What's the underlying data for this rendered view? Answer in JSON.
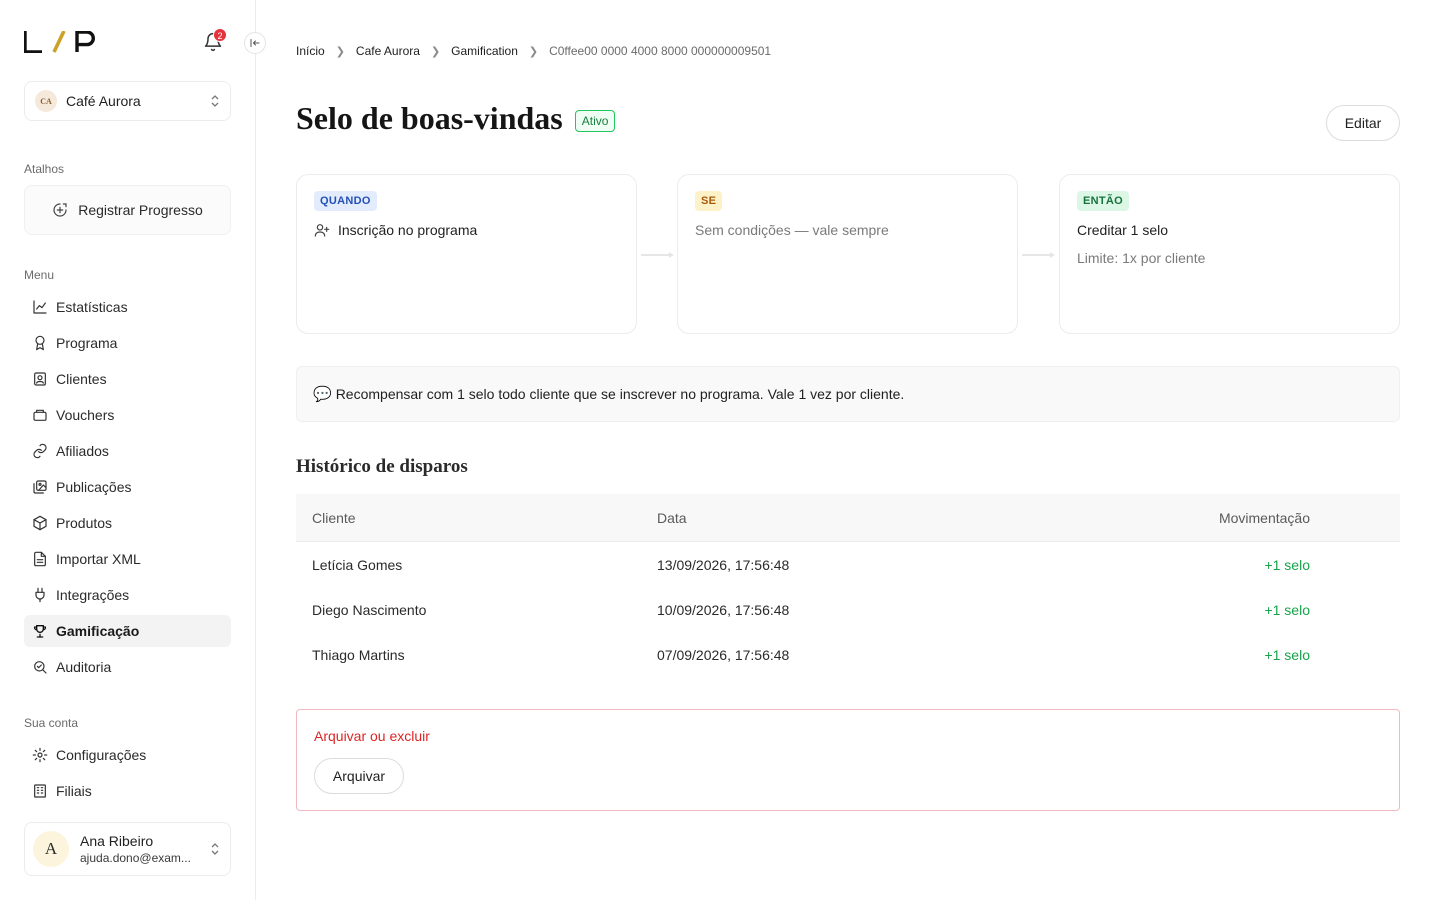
{
  "sidebar": {
    "logo_text": "L/P",
    "notifications_count": "2",
    "company": {
      "initials": "CA",
      "name": "Café Aurora"
    },
    "shortcuts_label": "Atalhos",
    "shortcut_button": "Registrar Progresso",
    "menu_label": "Menu",
    "menu_items": [
      {
        "label": "Estatísticas",
        "icon": "chart-line-icon"
      },
      {
        "label": "Programa",
        "icon": "award-icon"
      },
      {
        "label": "Clientes",
        "icon": "contact-card-icon"
      },
      {
        "label": "Vouchers",
        "icon": "ticket-icon"
      },
      {
        "label": "Afiliados",
        "icon": "link-icon"
      },
      {
        "label": "Publicações",
        "icon": "images-icon"
      },
      {
        "label": "Produtos",
        "icon": "package-icon"
      },
      {
        "label": "Importar XML",
        "icon": "file-icon"
      },
      {
        "label": "Integrações",
        "icon": "plug-icon"
      },
      {
        "label": "Gamificação",
        "icon": "trophy-icon",
        "active": true
      },
      {
        "label": "Auditoria",
        "icon": "search-audit-icon"
      }
    ],
    "account_label": "Sua conta",
    "account_items": [
      {
        "label": "Configurações",
        "icon": "gear-icon"
      },
      {
        "label": "Filiais",
        "icon": "building-icon"
      }
    ],
    "user": {
      "initial": "A",
      "name": "Ana Ribeiro",
      "email": "ajuda.dono@exam..."
    }
  },
  "breadcrumb": [
    "Início",
    "Cafe Aurora",
    "Gamification",
    "C0ffee00 0000 4000 8000 000000009501"
  ],
  "page": {
    "title": "Selo de boas-vindas",
    "status": "Ativo",
    "edit_button": "Editar"
  },
  "rule": {
    "when": {
      "tag": "QUANDO",
      "text": "Inscrição no programa"
    },
    "if": {
      "tag": "SE",
      "text": "Sem condições — vale sempre"
    },
    "then": {
      "tag": "ENTÃO",
      "text": "Creditar 1 selo",
      "sub": "Limite: 1x por cliente"
    }
  },
  "note": {
    "emoji": "💬",
    "text": "Recompensar com 1 selo todo cliente que se inscrever no programa. Vale 1 vez por cliente."
  },
  "history": {
    "title": "Histórico de disparos",
    "columns": [
      "Cliente",
      "Data",
      "Movimentação"
    ],
    "rows": [
      [
        "Letícia Gomes",
        "13/09/2026, 17:56:48",
        "+1 selo"
      ],
      [
        "Diego Nascimento",
        "10/09/2026, 17:56:48",
        "+1 selo"
      ],
      [
        "Thiago Martins",
        "07/09/2026, 17:56:48",
        "+1 selo"
      ]
    ]
  },
  "danger": {
    "title": "Arquivar ou excluir",
    "button": "Arquivar"
  },
  "colors": {
    "active_green": "#16a34a",
    "danger_red": "#dc2626",
    "badge_red": "#e5323b"
  }
}
